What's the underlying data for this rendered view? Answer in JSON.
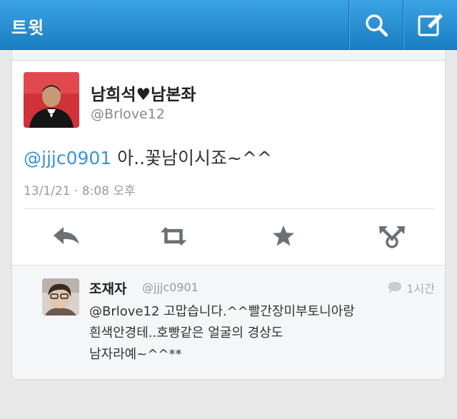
{
  "header": {
    "title": "트윗",
    "search_icon": "search-icon",
    "compose_icon": "compose-icon"
  },
  "tweet": {
    "author_name": "남희석♥남본좌",
    "author_handle": "@Brlove12",
    "mention": "@jjjc0901",
    "text": " 아..꽃남이시죠~^^",
    "timestamp": "13/1/21 · 8:08 오후",
    "actions": {
      "reply_icon": "reply-icon",
      "retweet_icon": "retweet-icon",
      "favorite_icon": "star-icon",
      "more_icon": "more-icon"
    }
  },
  "reply": {
    "author_name": "조재자",
    "author_handle": "@jjjc0901",
    "time": "1시간",
    "lines": [
      "@Brlove12 고맙습니다.^^빨간장미부토니아랑",
      "흰색안경테..호빵같은 얼굴의 경상도",
      "남자라예~^^**"
    ]
  },
  "colors": {
    "header_top": "#3aa3e3",
    "header_bottom": "#1a7ec2",
    "mention": "#3b94d9",
    "background": "#e8e8e8"
  }
}
